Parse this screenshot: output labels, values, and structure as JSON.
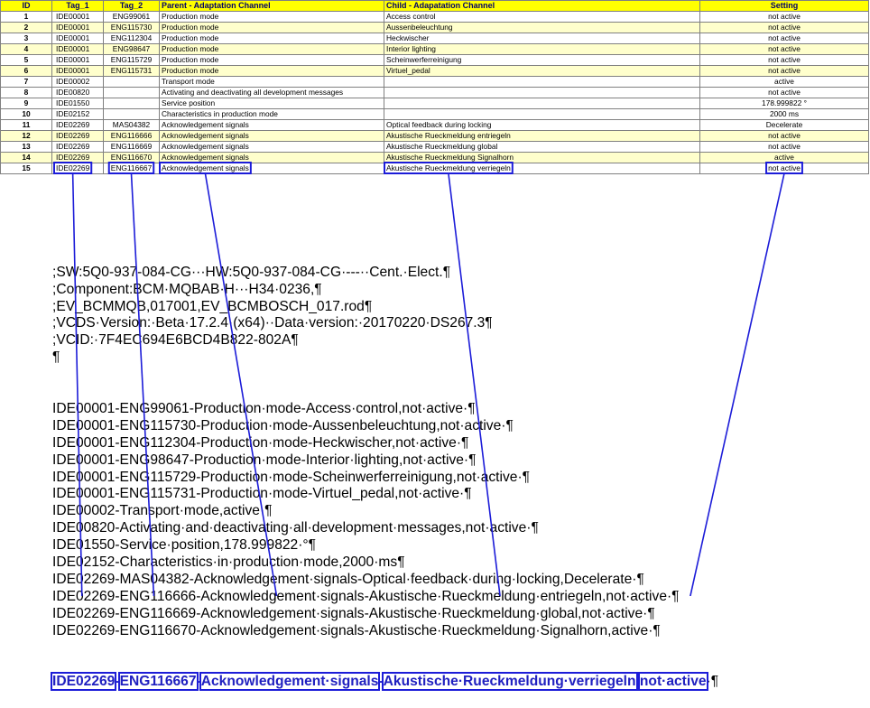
{
  "table": {
    "headers": [
      "ID",
      "Tag_1",
      "Tag_2",
      "Parent - Adaptation Channel",
      "Child - Adapatation Channel",
      "Setting"
    ],
    "rows": [
      {
        "id": "1",
        "tag1": "IDE00001",
        "tag2": "ENG99061",
        "parent": "Production mode",
        "child": "Access control",
        "setting": "not active"
      },
      {
        "id": "2",
        "tag1": "IDE00001",
        "tag2": "ENG115730",
        "parent": "Production mode",
        "child": "Aussenbeleuchtung",
        "setting": "not active"
      },
      {
        "id": "3",
        "tag1": "IDE00001",
        "tag2": "ENG112304",
        "parent": "Production mode",
        "child": "Heckwischer",
        "setting": "not active"
      },
      {
        "id": "4",
        "tag1": "IDE00001",
        "tag2": "ENG98647",
        "parent": "Production mode",
        "child": "Interior lighting",
        "setting": "not active"
      },
      {
        "id": "5",
        "tag1": "IDE00001",
        "tag2": "ENG115729",
        "parent": "Production mode",
        "child": "Scheinwerferreinigung",
        "setting": "not active"
      },
      {
        "id": "6",
        "tag1": "IDE00001",
        "tag2": "ENG115731",
        "parent": "Production mode",
        "child": "Virtuel_pedal",
        "setting": "not active"
      },
      {
        "id": "7",
        "tag1": "IDE00002",
        "tag2": "",
        "parent": "Transport mode",
        "child": "",
        "setting": "active"
      },
      {
        "id": "8",
        "tag1": "IDE00820",
        "tag2": "",
        "parent": "Activating and deactivating all development messages",
        "child": "",
        "setting": "not active"
      },
      {
        "id": "9",
        "tag1": "IDE01550",
        "tag2": "",
        "parent": "Service position",
        "child": "",
        "setting": "178.999822 °"
      },
      {
        "id": "10",
        "tag1": "IDE02152",
        "tag2": "",
        "parent": "Characteristics in production mode",
        "child": "",
        "setting": "2000 ms"
      },
      {
        "id": "11",
        "tag1": "IDE02269",
        "tag2": "MAS04382",
        "parent": "Acknowledgement signals",
        "child": "Optical feedback during locking",
        "setting": "Decelerate"
      },
      {
        "id": "12",
        "tag1": "IDE02269",
        "tag2": "ENG116666",
        "parent": "Acknowledgement signals",
        "child": "Akustische Rueckmeldung entriegeln",
        "setting": "not active"
      },
      {
        "id": "13",
        "tag1": "IDE02269",
        "tag2": "ENG116669",
        "parent": "Acknowledgement signals",
        "child": "Akustische Rueckmeldung global",
        "setting": "not active"
      },
      {
        "id": "14",
        "tag1": "IDE02269",
        "tag2": "ENG116670",
        "parent": "Acknowledgement signals",
        "child": "Akustische Rueckmeldung Signalhorn",
        "setting": "active"
      },
      {
        "id": "15",
        "tag1": "IDE02269",
        "tag2": "ENG116667",
        "parent": "Acknowledgement signals",
        "child": "Akustische Rueckmeldung verriegeln",
        "setting": "not active"
      }
    ]
  },
  "document": {
    "header_lines": [
      ";SW:5Q0-937-084-CG···HW:5Q0-937-084-CG·---··Cent.·Elect.¶",
      ";Component:BCM·MQBAB·H···H34·0236,¶",
      ";EV_BCMMQB,017001,EV_BCMBOSCH_017.rod¶",
      ";VCDS·Version:·Beta·17.2.4·(x64)··Data·version:·20170220·DS267.3¶",
      ";VCID:·7F4EC694E6BCD4B822-802A¶",
      "¶"
    ],
    "data_lines": [
      "IDE00001-ENG99061-Production·mode-Access·control,not·active·¶",
      "IDE00001-ENG115730-Production·mode-Aussenbeleuchtung,not·active·¶",
      "IDE00001-ENG112304-Production·mode-Heckwischer,not·active·¶",
      "IDE00001-ENG98647-Production·mode-Interior·lighting,not·active·¶",
      "IDE00001-ENG115729-Production·mode-Scheinwerferreinigung,not·active·¶",
      "IDE00001-ENG115731-Production·mode-Virtuel_pedal,not·active·¶",
      "IDE00002-Transport·mode,active·¶",
      "IDE00820-Activating·and·deactivating·all·development·messages,not·active·¶",
      "IDE01550-Service·position,178.999822·°¶",
      "IDE02152-Characteristics·in·production·mode,2000·ms¶",
      "IDE02269-MAS04382-Acknowledgement·signals-Optical·feedback·during·locking,Decelerate·¶",
      "IDE02269-ENG116666-Acknowledgement·signals-Akustische·Rueckmeldung·entriegeln,not·active·¶",
      "IDE02269-ENG116669-Acknowledgement·signals-Akustische·Rueckmeldung·global,not·active·¶",
      "IDE02269-ENG116670-Acknowledgement·signals-Akustische·Rueckmeldung·Signalhorn,active·¶"
    ],
    "final_line": {
      "tag1": "IDE02269",
      "tag2": "ENG116667",
      "parent": "Acknowledgement·signals",
      "child": "Akustische·Rueckmeldung·verriegeln",
      "setting": "not·active",
      "pilcrow": "·¶"
    }
  },
  "colors": {
    "header_bg": "#ffff00",
    "highlight_row_bg": "#ffffcc",
    "mapping_lines": "#1c1cd8"
  }
}
